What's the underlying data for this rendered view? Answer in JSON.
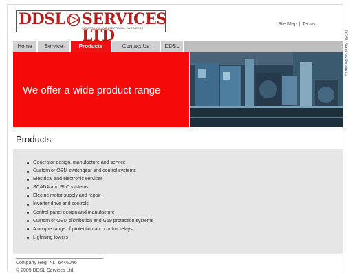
{
  "logo": {
    "left": "DDSL",
    "right": "SERVICES LTD",
    "tagline": "Electronic and Electrical Engineers"
  },
  "toplinks": {
    "sitemap": "Site Map",
    "separator": "|",
    "terms": "Terms"
  },
  "nav": {
    "items": [
      {
        "label": "Home",
        "active": false
      },
      {
        "label": "Service",
        "active": false
      },
      {
        "label": "Products",
        "active": true
      },
      {
        "label": "Contact Us",
        "active": false
      },
      {
        "label": "DDSL",
        "active": false
      }
    ]
  },
  "hero": {
    "headline": "We offer a wide product range"
  },
  "main": {
    "heading": "Products",
    "items": [
      "Generator design, manufacture and service",
      "Custom or OEM switchgear and control systems",
      "Electrical and electronic services",
      "SCADA and PLC systems",
      "Electric motor supply and repair",
      "Inverter drive and controls",
      "Control panel design and manufacture",
      "Custom or OEM distribution and G59 protection systems",
      "A unique range of protection and control relays",
      "Lightning towers"
    ]
  },
  "footer": {
    "company_reg": "Company Reg. Nr.: 6446046",
    "copyright": "© 2009 DDSL Services Ltd"
  },
  "side_text": "DDSL Services Products",
  "colors": {
    "accent_red": "#f50a0a",
    "nav_active": "#ee1111",
    "content_bg": "#e6e6e6"
  }
}
